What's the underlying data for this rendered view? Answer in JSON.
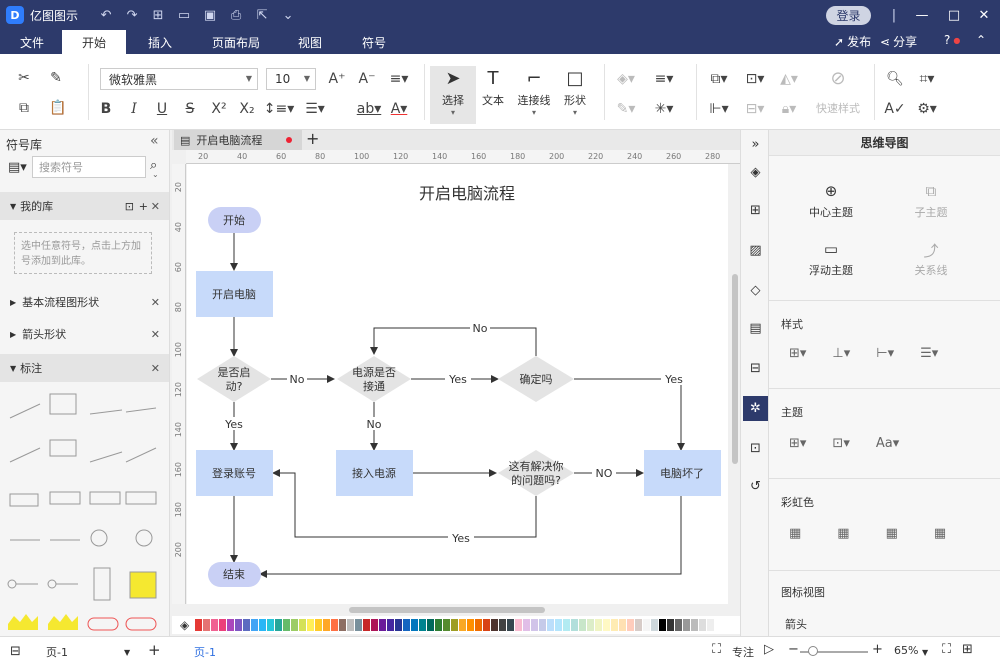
{
  "app": {
    "title": "亿图图示",
    "logo": "D"
  },
  "titlebar": {
    "login": "登录",
    "quick": [
      "undo-icon",
      "redo-icon",
      "new-icon",
      "open-icon",
      "save-icon",
      "print-icon",
      "export-icon",
      "more-icon"
    ]
  },
  "menu": {
    "tabs": [
      "文件",
      "开始",
      "插入",
      "页面布局",
      "视图",
      "符号"
    ],
    "active": "开始",
    "publish": "发布",
    "share": "分享",
    "help": "?"
  },
  "ribbon": {
    "font": "微软雅黑",
    "size": "10",
    "tools": [
      {
        "label": "选择"
      },
      {
        "label": "文本"
      },
      {
        "label": "连接线"
      },
      {
        "label": "形状"
      }
    ],
    "quick_style": "快速样式"
  },
  "library": {
    "header": "符号库",
    "search_placeholder": "搜索符号",
    "my_lib": "我的库",
    "hint": "选中任意符号，点击上方加号添加到此库。",
    "sections": [
      "基本流程图形状",
      "箭头形状",
      "标注"
    ]
  },
  "doc": {
    "tab": "开启电脑流程",
    "add": "+"
  },
  "ruler": {
    "top": [
      "20",
      "40",
      "60",
      "80",
      "100",
      "120",
      "140",
      "160",
      "180",
      "200",
      "220",
      "240",
      "260",
      "280"
    ],
    "left": [
      "20",
      "40",
      "60",
      "80",
      "100",
      "120",
      "140",
      "160",
      "180",
      "200"
    ]
  },
  "diagram": {
    "title": "开启电脑流程",
    "nodes": {
      "start": "开始",
      "boot": "开启电脑",
      "startup": [
        "是否启",
        "动?"
      ],
      "power": [
        "电源是否",
        "接通"
      ],
      "confirm": "确定吗",
      "login": "登录账号",
      "plug": "接入电源",
      "solved": [
        "这有解决你",
        "的问题吗?"
      ],
      "broken": "电脑坏了",
      "end": "结束"
    },
    "labels": {
      "no1": "No",
      "no2": "No",
      "no3": "No",
      "no4": "NO",
      "yes1": "Yes",
      "yes2": "Yes",
      "yes3": "Yes",
      "yes4": "Yes"
    }
  },
  "palette": [
    "#e53935",
    "#e57373",
    "#f06292",
    "#ec407a",
    "#ab47bc",
    "#7e57c2",
    "#5c6bc0",
    "#42a5f5",
    "#29b6f6",
    "#26c6da",
    "#26a69a",
    "#66bb6a",
    "#9ccc65",
    "#d4e157",
    "#ffee58",
    "#ffca28",
    "#ffa726",
    "#ff7043",
    "#8d6e63",
    "#bdbdbd",
    "#78909c",
    "#c62828",
    "#ad1457",
    "#6a1b9a",
    "#4527a0",
    "#283593",
    "#1565c0",
    "#0277bd",
    "#00838f",
    "#00695c",
    "#2e7d32",
    "#558b2f",
    "#9e9d24",
    "#f9a825",
    "#ff8f00",
    "#ef6c00",
    "#d84315",
    "#4e342e",
    "#424242",
    "#37474f",
    "#f8bbd0",
    "#e1bee7",
    "#d1c4e9",
    "#c5cae9",
    "#bbdefb",
    "#b3e5fc",
    "#b2ebf2",
    "#b2dfdb",
    "#c8e6c9",
    "#dcedc8",
    "#f0f4c3",
    "#fff9c4",
    "#ffecb3",
    "#ffe0b2",
    "#ffccbc",
    "#d7ccc8",
    "#f5f5f5",
    "#cfd8dc",
    "#000000",
    "#333333",
    "#666666",
    "#999999",
    "#bbbbbb",
    "#dddddd",
    "#eeeeee",
    "#ffffff"
  ],
  "rpanel": {
    "title": "思维导图",
    "topics": [
      {
        "label": "中心主题",
        "icon": "⊕",
        "dim": false
      },
      {
        "label": "子主题",
        "icon": "⧉",
        "dim": true
      },
      {
        "label": "浮动主题",
        "icon": "▭",
        "dim": false
      },
      {
        "label": "关系线",
        "icon": "⤴",
        "dim": true
      }
    ],
    "style": "样式",
    "theme": "主题",
    "rainbow": "彩虹色",
    "chart_view": "图标视图",
    "arrow": "箭头"
  },
  "status": {
    "page": "页-1",
    "page_tab": "页-1",
    "focus": "专注",
    "zoom": "65%",
    "add": "+"
  }
}
